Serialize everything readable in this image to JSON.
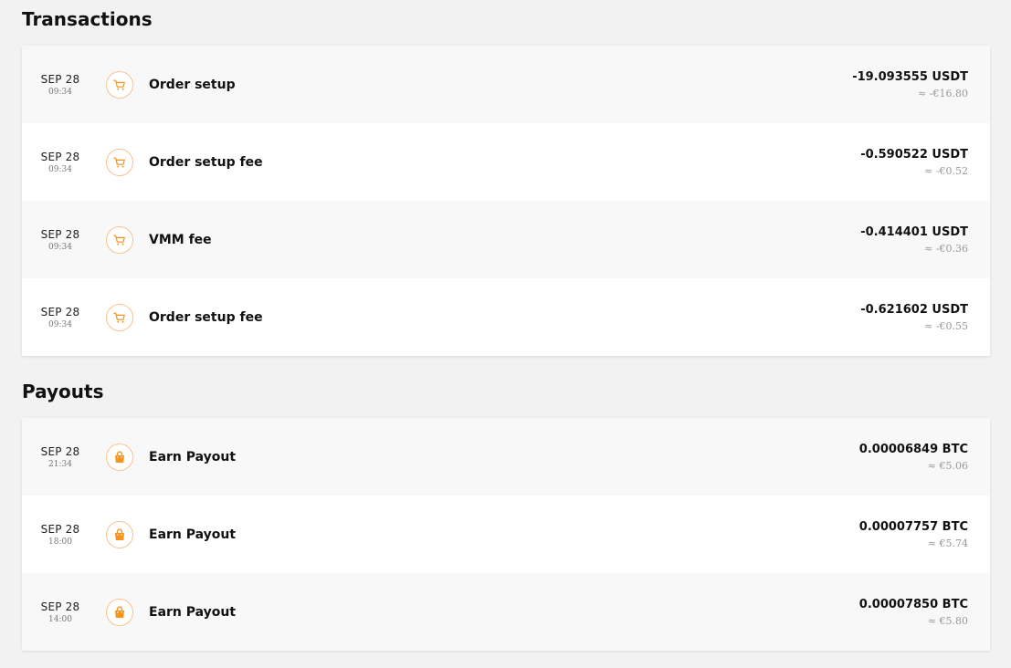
{
  "transactions": {
    "title": "Transactions",
    "items": [
      {
        "date": "SEP 28",
        "time": "09:34",
        "label": "Order setup",
        "amount": "-19.093555 USDT",
        "fiat": "≈ -€16.80",
        "icon": "cart-icon"
      },
      {
        "date": "SEP 28",
        "time": "09:34",
        "label": "Order setup fee",
        "amount": "-0.590522 USDT",
        "fiat": "≈ -€0.52",
        "icon": "cart-icon"
      },
      {
        "date": "SEP 28",
        "time": "09:34",
        "label": "VMM fee",
        "amount": "-0.414401 USDT",
        "fiat": "≈ -€0.36",
        "icon": "cart-icon"
      },
      {
        "date": "SEP 28",
        "time": "09:34",
        "label": "Order setup fee",
        "amount": "-0.621602 USDT",
        "fiat": "≈ -€0.55",
        "icon": "cart-icon"
      }
    ]
  },
  "payouts": {
    "title": "Payouts",
    "items": [
      {
        "date": "SEP 28",
        "time": "21:34",
        "label": "Earn Payout",
        "amount": "0.00006849 BTC",
        "fiat": "≈ €5.06",
        "icon": "shopping-bag-icon"
      },
      {
        "date": "SEP 28",
        "time": "18:00",
        "label": "Earn Payout",
        "amount": "0.00007757 BTC",
        "fiat": "≈ €5.74",
        "icon": "shopping-bag-icon"
      },
      {
        "date": "SEP 28",
        "time": "14:00",
        "label": "Earn Payout",
        "amount": "0.00007850 BTC",
        "fiat": "≈ €5.80",
        "icon": "shopping-bag-icon"
      }
    ]
  },
  "colors": {
    "accent": "#f7931e",
    "accent_ring": "#f8c38f",
    "background": "#f2f2f2",
    "row_alt": "#f8f8f8"
  }
}
